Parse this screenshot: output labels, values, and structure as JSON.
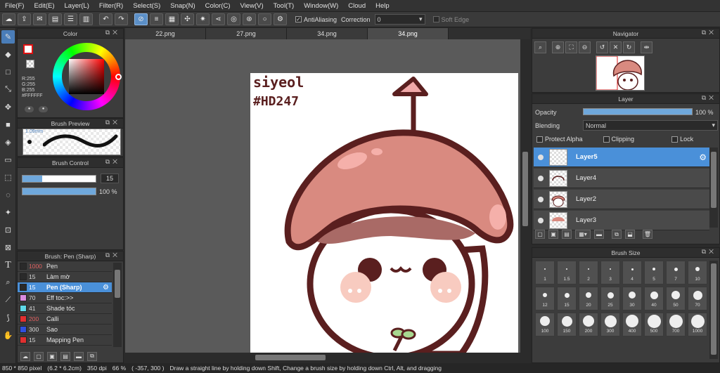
{
  "menu": [
    "File(F)",
    "Edit(E)",
    "Layer(L)",
    "Filter(R)",
    "Select(S)",
    "Snap(N)",
    "Color(C)",
    "View(V)",
    "Tool(T)",
    "Window(W)",
    "Cloud",
    "Help"
  ],
  "toolbar": {
    "antialiasing_label": "AntiAliasing",
    "correction_label": "Correction",
    "correction_value": "0",
    "soft_edge_label": "Soft Edge"
  },
  "color_panel": {
    "title": "Color",
    "r": "R:255",
    "g": "G:255",
    "b": "B:255",
    "hex": "#FFFFFF",
    "fg_color": "#e01010",
    "bg_color": "#ffffff"
  },
  "brush_preview": {
    "title": "Brush Preview",
    "size_text": "1.09mm"
  },
  "brush_control": {
    "title": "Brush Control",
    "size_value": "15",
    "opacity_value": "100 %",
    "size_fraction": 0.27,
    "opacity_fraction": 1.0
  },
  "brush_list": {
    "title": "Brush: Pen (Sharp)",
    "items": [
      {
        "size": "1000",
        "name": "Pen",
        "color": "#2a2a2a",
        "num_color": "#e06060"
      },
      {
        "size": "15",
        "name": "Làm mờ",
        "color": "#2a2a2a",
        "num_color": "#d8d8d8"
      },
      {
        "size": "15",
        "name": "Pen (Sharp)",
        "color": "#2a2a2a",
        "num_color": "#e06060"
      },
      {
        "size": "70",
        "name": "Eff toc:>>",
        "color": "#d98adf",
        "num_color": "#d8d8d8"
      },
      {
        "size": "41",
        "name": "Shade tóc",
        "color": "#5fd9e8",
        "num_color": "#d8d8d8"
      },
      {
        "size": "200",
        "name": "Calli",
        "color": "#e03030",
        "num_color": "#e06060"
      },
      {
        "size": "300",
        "name": "Sao",
        "color": "#3050e0",
        "num_color": "#d8d8d8"
      },
      {
        "size": "15",
        "name": "Mapping Pen",
        "color": "#e03030",
        "num_color": "#d8d8d8"
      }
    ]
  },
  "tabs": [
    "22.png",
    "27.png",
    "34.png",
    "34.png"
  ],
  "canvas": {
    "text_line1": "siyeol",
    "text_line2": "#HD247"
  },
  "navigator": {
    "title": "Navigator"
  },
  "layer_panel": {
    "title": "Layer",
    "opacity_label": "Opacity",
    "opacity_value": "100 %",
    "blending_label": "Blending",
    "blending_value": "Normal",
    "protect_alpha": "Protect Alpha",
    "clipping": "Clipping",
    "lock": "Lock",
    "layers": [
      "Layer5",
      "Layer4",
      "Layer2",
      "Layer3"
    ]
  },
  "brush_size": {
    "title": "Brush Size",
    "sizes": [
      "1",
      "1.5",
      "2",
      "3",
      "4",
      "5",
      "7",
      "10",
      "12",
      "15",
      "20",
      "25",
      "30",
      "40",
      "50",
      "70",
      "100",
      "150",
      "200",
      "300",
      "400",
      "500",
      "700",
      "1000"
    ]
  },
  "status": {
    "dimensions": "850 * 850 pixel",
    "physical": "(6.2 * 6.2cm)",
    "dpi": "350 dpi",
    "zoom": "66 %",
    "coords": "( -357, 300 )",
    "hint": "Draw a straight line by holding down Shift, Change a brush size by holding down Ctrl, Alt, and dragging"
  }
}
